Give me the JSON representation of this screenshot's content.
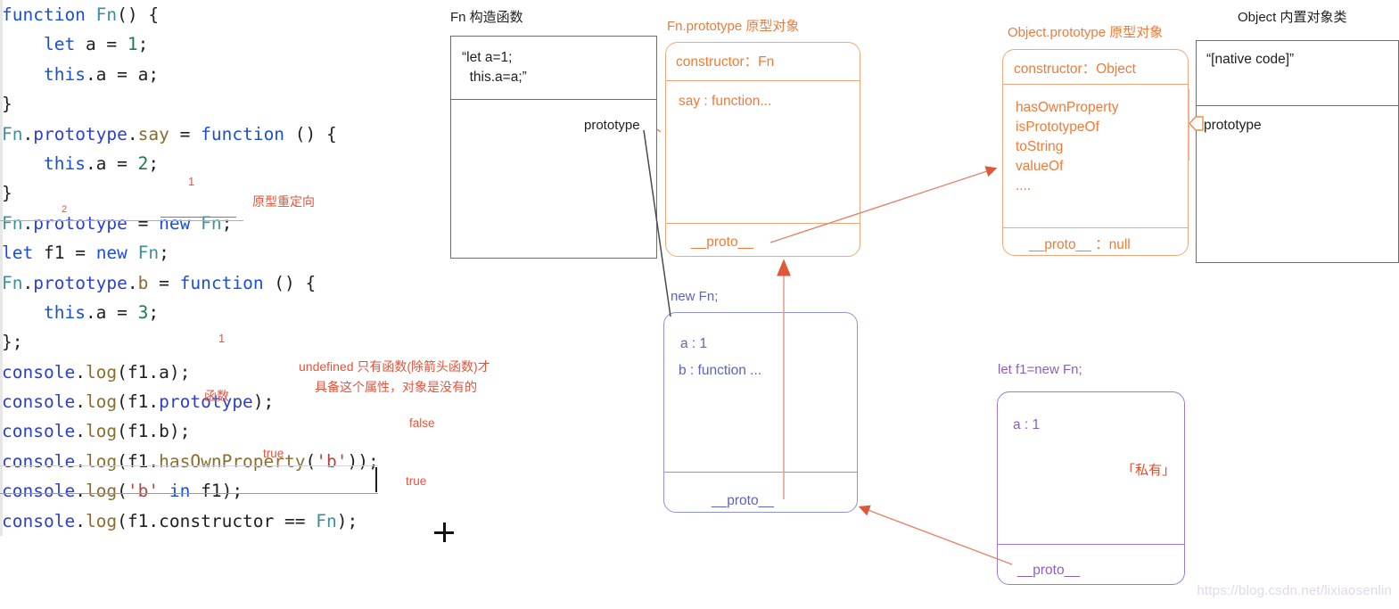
{
  "editor": {
    "lines": [
      [
        {
          "t": "function ",
          "c": "kw"
        },
        {
          "t": "Fn",
          "c": "fn"
        },
        {
          "t": "() {",
          "c": "plain"
        }
      ],
      [
        {
          "t": "    ",
          "c": "plain"
        },
        {
          "t": "let",
          "c": "kw"
        },
        {
          "t": " a = ",
          "c": "plain"
        },
        {
          "t": "1",
          "c": "num"
        },
        {
          "t": ";",
          "c": "plain"
        }
      ],
      [
        {
          "t": "    ",
          "c": "plain"
        },
        {
          "t": "this",
          "c": "kw"
        },
        {
          "t": ".a = a;",
          "c": "plain"
        }
      ],
      [
        {
          "t": "}",
          "c": "plain"
        }
      ],
      [
        {
          "t": "Fn",
          "c": "fn"
        },
        {
          "t": ".",
          "c": "plain"
        },
        {
          "t": "prototype",
          "c": "obj"
        },
        {
          "t": ".",
          "c": "plain"
        },
        {
          "t": "say",
          "c": "prop"
        },
        {
          "t": " = ",
          "c": "plain"
        },
        {
          "t": "function",
          "c": "kw"
        },
        {
          "t": " () {",
          "c": "plain"
        }
      ],
      [
        {
          "t": "    ",
          "c": "plain"
        },
        {
          "t": "this",
          "c": "kw"
        },
        {
          "t": ".a = ",
          "c": "plain"
        },
        {
          "t": "2",
          "c": "num"
        },
        {
          "t": ";",
          "c": "plain"
        }
      ],
      [
        {
          "t": "}",
          "c": "plain"
        }
      ],
      [
        {
          "t": "Fn",
          "c": "fn"
        },
        {
          "t": ".",
          "c": "plain"
        },
        {
          "t": "prototype",
          "c": "obj"
        },
        {
          "t": " = ",
          "c": "plain"
        },
        {
          "t": "new",
          "c": "kw"
        },
        {
          "t": " ",
          "c": "plain"
        },
        {
          "t": "Fn",
          "c": "fn"
        },
        {
          "t": ";",
          "c": "plain"
        }
      ],
      [
        {
          "t": "let",
          "c": "kw"
        },
        {
          "t": " f1 = ",
          "c": "plain"
        },
        {
          "t": "new",
          "c": "kw"
        },
        {
          "t": " ",
          "c": "plain"
        },
        {
          "t": "Fn",
          "c": "fn"
        },
        {
          "t": ";",
          "c": "plain"
        }
      ],
      [
        {
          "t": "Fn",
          "c": "fn"
        },
        {
          "t": ".",
          "c": "plain"
        },
        {
          "t": "prototype",
          "c": "obj"
        },
        {
          "t": ".",
          "c": "plain"
        },
        {
          "t": "b",
          "c": "prop"
        },
        {
          "t": " = ",
          "c": "plain"
        },
        {
          "t": "function",
          "c": "kw"
        },
        {
          "t": " () {",
          "c": "plain"
        }
      ],
      [
        {
          "t": "    ",
          "c": "plain"
        },
        {
          "t": "this",
          "c": "kw"
        },
        {
          "t": ".a = ",
          "c": "plain"
        },
        {
          "t": "3",
          "c": "num"
        },
        {
          "t": ";",
          "c": "plain"
        }
      ],
      [
        {
          "t": "};",
          "c": "plain"
        }
      ],
      [
        {
          "t": "console",
          "c": "obj"
        },
        {
          "t": ".",
          "c": "plain"
        },
        {
          "t": "log",
          "c": "prop"
        },
        {
          "t": "(f1.a);",
          "c": "plain"
        }
      ],
      [
        {
          "t": "console",
          "c": "obj"
        },
        {
          "t": ".",
          "c": "plain"
        },
        {
          "t": "log",
          "c": "prop"
        },
        {
          "t": "(f1.",
          "c": "plain"
        },
        {
          "t": "prototype",
          "c": "obj"
        },
        {
          "t": ");",
          "c": "plain"
        }
      ],
      [
        {
          "t": "console",
          "c": "obj"
        },
        {
          "t": ".",
          "c": "plain"
        },
        {
          "t": "log",
          "c": "prop"
        },
        {
          "t": "(f1.b);",
          "c": "plain"
        }
      ],
      [
        {
          "t": "console",
          "c": "obj"
        },
        {
          "t": ".",
          "c": "plain"
        },
        {
          "t": "log",
          "c": "prop"
        },
        {
          "t": "(f1.",
          "c": "plain"
        },
        {
          "t": "hasOwnProperty",
          "c": "prop"
        },
        {
          "t": "(",
          "c": "plain"
        },
        {
          "t": "'b'",
          "c": "str"
        },
        {
          "t": "));",
          "c": "plain"
        }
      ],
      [
        {
          "t": "console",
          "c": "obj"
        },
        {
          "t": ".",
          "c": "plain"
        },
        {
          "t": "log",
          "c": "prop"
        },
        {
          "t": "(",
          "c": "plain"
        },
        {
          "t": "'b'",
          "c": "str"
        },
        {
          "t": " ",
          "c": "plain"
        },
        {
          "t": "in",
          "c": "kw"
        },
        {
          "t": " f1);",
          "c": "plain"
        }
      ],
      [
        {
          "t": "console",
          "c": "obj"
        },
        {
          "t": ".",
          "c": "plain"
        },
        {
          "t": "log",
          "c": "prop"
        },
        {
          "t": "(f1.",
          "c": "plain"
        },
        {
          "t": "constructor",
          "c": "plain"
        },
        {
          "t": " == ",
          "c": "plain"
        },
        {
          "t": "Fn",
          "c": "fn"
        },
        {
          "t": ");",
          "c": "plain"
        }
      ]
    ],
    "annotations": {
      "marker_one_redirect": "1",
      "marker_two_prototype": "2",
      "redirect_note": "原型重定向",
      "log_a_result": "1",
      "log_prototype_result": "undefined 只有函数(除箭头函数)才",
      "log_prototype_result_line2": "具备这个属性，对象是没有的",
      "log_b_result": "函数",
      "log_hasown_result": "false",
      "log_in_result": "true",
      "log_constructor_result": "true"
    }
  },
  "diagram": {
    "fn_box": {
      "title": "Fn 构造函数",
      "code_line1": "“let a=1;",
      "code_line2": "  this.a=a;”",
      "prototype_label": "prototype"
    },
    "fn_prototype_box": {
      "title": "Fn.prototype 原型对象",
      "constructor_row": "constructor：Fn",
      "say_row": "say : function...",
      "proto_row": "__proto__"
    },
    "object_prototype_box": {
      "title": "Object.prototype 原型对象",
      "constructor_row": "constructor：Object",
      "methods": [
        "hasOwnProperty",
        "isPrototypeOf",
        "toString",
        "valueOf",
        "...."
      ],
      "proto_row": "__proto__ ：null"
    },
    "object_class_box": {
      "title": "Object 内置对象类",
      "native_code": "“[native code]”",
      "prototype_label": "prototype"
    },
    "new_fn_box": {
      "label": "new Fn;",
      "row_a": "a : 1",
      "row_b": "b : function ...",
      "proto_row": "__proto__"
    },
    "f1_box": {
      "label": "let f1=new Fn;",
      "row_a": "a : 1",
      "private_note": "「私有」",
      "proto_row": "__proto__"
    }
  },
  "watermark": "https://blog.csdn.net/lixiaosenlin",
  "colors": {
    "orange": "#ef7b39",
    "orange_border": "#f0a878",
    "blue": "#5b63c4",
    "purple": "#8a5fc0",
    "red_arrow": "#e0583a",
    "annotation_red": "#e2543c"
  }
}
